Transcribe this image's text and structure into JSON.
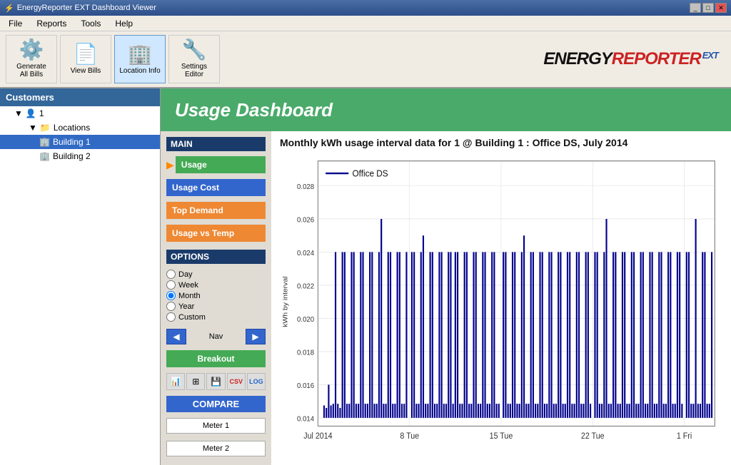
{
  "window": {
    "title": "EnergyReporter EXT Dashboard Viewer",
    "icon": "⚡"
  },
  "menu": {
    "items": [
      "File",
      "Reports",
      "Tools",
      "Help"
    ]
  },
  "toolbar": {
    "buttons": [
      {
        "id": "generate-bills",
        "label": "Generate\nAll Bills",
        "icon": "⚙️"
      },
      {
        "id": "view-bills",
        "label": "View Bills",
        "icon": "📄"
      },
      {
        "id": "location-info",
        "label": "Location Info",
        "icon": "🏢",
        "active": true
      },
      {
        "id": "settings-editor",
        "label": "Settings Editor",
        "icon": "🔧"
      }
    ],
    "logo": "ENERGYREPORTER",
    "logo_ext": "EXT"
  },
  "sidebar": {
    "header": "Customers",
    "tree": [
      {
        "id": "customer-1",
        "label": "1",
        "icon": "👤",
        "indent": 1
      },
      {
        "id": "locations",
        "label": "Locations",
        "icon": "📁",
        "indent": 2
      },
      {
        "id": "building-1",
        "label": "Building 1",
        "icon": "🏢",
        "indent": 3,
        "selected": true
      },
      {
        "id": "building-2",
        "label": "Building 2",
        "icon": "🏢",
        "indent": 3,
        "selected": false
      }
    ]
  },
  "dashboard": {
    "header": "Usage Dashboard",
    "chart_title": "Monthly kWh usage interval data for 1 @ Building 1 : Office DS, July 2014",
    "legend": "Office DS",
    "x_label_start": "Jul 2014",
    "x_labels": [
      "Jul 2014",
      "8 Tue",
      "15 Tue",
      "22 Tue",
      "1 Fri"
    ],
    "y_label": "kWh by interval",
    "y_axis_values": [
      "0.028",
      "0.026",
      "0.024",
      "0.022",
      "0.020",
      "0.018",
      "0.016",
      "0.014"
    ]
  },
  "main_buttons": {
    "section": "MAIN",
    "buttons": [
      {
        "id": "usage",
        "label": "Usage",
        "color": "green"
      },
      {
        "id": "usage-cost",
        "label": "Usage Cost",
        "color": "blue"
      },
      {
        "id": "top-demand",
        "label": "Top Demand",
        "color": "orange"
      },
      {
        "id": "usage-vs-temp",
        "label": "Usage vs Temp",
        "color": "orange"
      }
    ]
  },
  "options": {
    "section": "OPTIONS",
    "radio_items": [
      {
        "id": "day",
        "label": "Day",
        "checked": false
      },
      {
        "id": "week",
        "label": "Week",
        "checked": false
      },
      {
        "id": "month",
        "label": "Month",
        "checked": true
      },
      {
        "id": "year",
        "label": "Year",
        "checked": false
      },
      {
        "id": "custom",
        "label": "Custom",
        "checked": false
      }
    ],
    "nav_label": "Nav"
  },
  "breakout": {
    "label": "Breakout"
  },
  "compare": {
    "header": "COMPARE",
    "meter1": "Meter 1",
    "meter2": "Meter 2"
  }
}
